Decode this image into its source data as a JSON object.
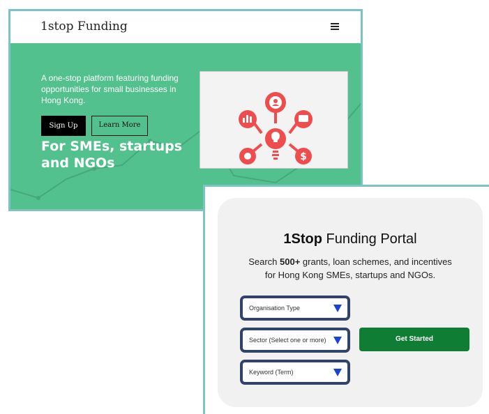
{
  "window1": {
    "brand": "1stop Funding",
    "intro": "A one-stop platform featuring funding opportunities for small businesses in Hong Kong.",
    "signup_label": "Sign Up",
    "learn_label": "Learn More",
    "headline": "For SMEs, startups and NGOs",
    "colors": {
      "hero_bg": "#52c18e",
      "icon_red": "#ef4d4d"
    }
  },
  "window2": {
    "title_bold": "1Stop",
    "title_rest": " Funding Portal",
    "sub_before": "Search ",
    "sub_bold": "500+",
    "sub_after": " grants, loan schemes, and incentives",
    "sub_line2": "for Hong Kong SMEs, startups and NGOs.",
    "select1": "Organisation Type",
    "select2": "Sector (Select one or more)",
    "select3": "Keyword (Term)",
    "cta": "Get Started",
    "colors": {
      "select_border": "#334368",
      "arrow": "#1a45d3",
      "cta_bg": "#0f7d34"
    }
  }
}
